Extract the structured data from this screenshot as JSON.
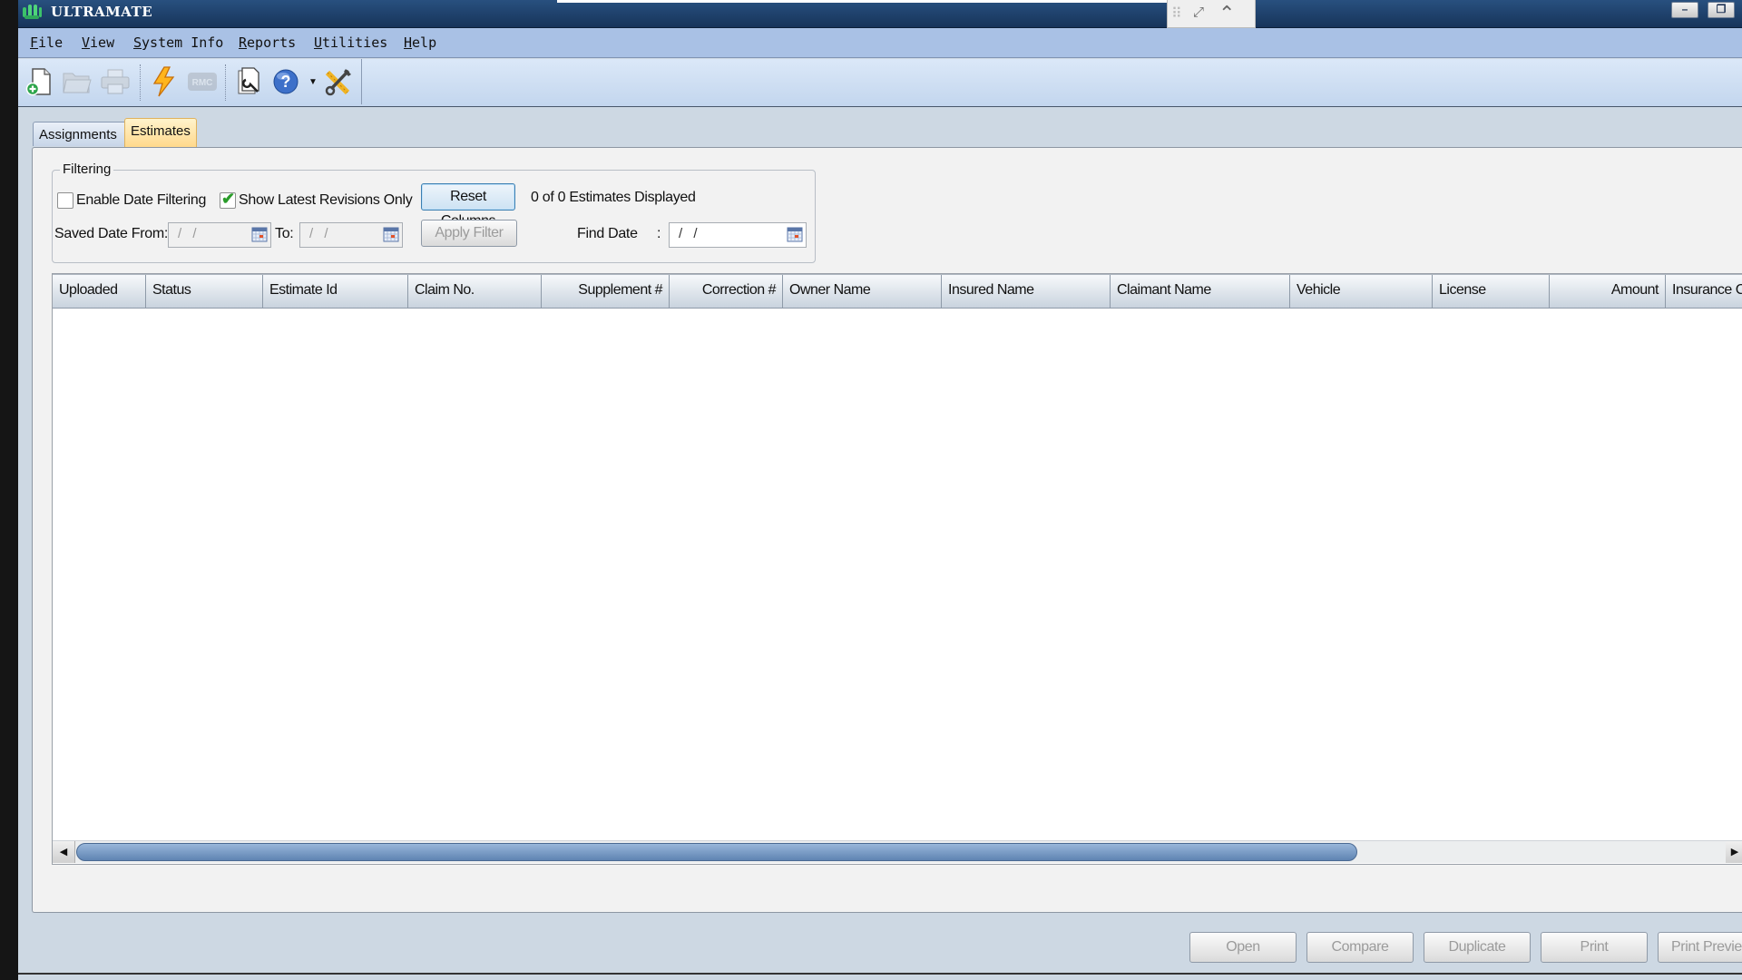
{
  "window": {
    "title": "ULTRAMATE",
    "controls": {
      "minimize": "–",
      "restore": "❐"
    }
  },
  "remote_toolbar": {
    "icons": [
      "pin-grid-icon",
      "fullscreen-icon",
      "collapse-icon"
    ]
  },
  "menu": {
    "items": [
      {
        "label": "File",
        "accel": "F"
      },
      {
        "label": "View",
        "accel": "V"
      },
      {
        "label": "System Info",
        "accel": "S"
      },
      {
        "label": "Reports",
        "accel": "R"
      },
      {
        "label": "Utilities",
        "accel": "U"
      },
      {
        "label": "Help",
        "accel": "H"
      }
    ]
  },
  "toolbar": {
    "buttons": [
      {
        "name": "new",
        "icon": "new-document-icon",
        "enabled": true
      },
      {
        "name": "open",
        "icon": "open-folder-icon",
        "enabled": false
      },
      {
        "name": "print",
        "icon": "printer-icon",
        "enabled": false
      },
      {
        "name": "quick",
        "icon": "lightning-icon",
        "enabled": true
      },
      {
        "name": "rmc",
        "icon": "rmc-icon",
        "label": "RMC",
        "enabled": false
      },
      {
        "name": "edit",
        "icon": "document-wrench-icon",
        "enabled": true
      },
      {
        "name": "help",
        "icon": "help-icon",
        "enabled": true
      },
      {
        "name": "tools",
        "icon": "tools-icon",
        "enabled": true
      }
    ]
  },
  "tabs": [
    {
      "label": "Assignments",
      "active": false
    },
    {
      "label": "Estimates",
      "active": true
    }
  ],
  "filtering": {
    "legend": "Filtering",
    "enable_date_filtering": {
      "label": "Enable Date Filtering",
      "checked": false
    },
    "show_latest_revisions": {
      "label": "Show Latest Revisions Only",
      "checked": true
    },
    "reset_columns_label": "Reset Columns",
    "status_text": "0 of 0 Estimates Displayed",
    "saved_date_from_label": "Saved Date From:",
    "saved_date_from_value": "/ /",
    "to_label": "To:",
    "to_value": "/ /",
    "apply_filter_label": "Apply Filter",
    "find_date_label": "Find Date",
    "find_date_colon": ":",
    "find_date_value": "/ /"
  },
  "grid": {
    "columns": [
      {
        "label": "Uploaded",
        "align": "left"
      },
      {
        "label": "Status",
        "align": "left"
      },
      {
        "label": "Estimate Id",
        "align": "left"
      },
      {
        "label": "Claim No.",
        "align": "left"
      },
      {
        "label": "Supplement #",
        "align": "right"
      },
      {
        "label": "Correction #",
        "align": "right"
      },
      {
        "label": "Owner Name",
        "align": "left"
      },
      {
        "label": "Insured Name",
        "align": "left"
      },
      {
        "label": "Claimant Name",
        "align": "left"
      },
      {
        "label": "Vehicle",
        "align": "left"
      },
      {
        "label": "License",
        "align": "left"
      },
      {
        "label": "Amount",
        "align": "right"
      },
      {
        "label": "Insurance C",
        "align": "left"
      }
    ],
    "rows": [],
    "scroll": {
      "left_arrow": "◀",
      "right_arrow": "▶"
    }
  },
  "actions": [
    {
      "label": "Open",
      "enabled": false
    },
    {
      "label": "Compare",
      "enabled": false
    },
    {
      "label": "Duplicate",
      "enabled": false
    },
    {
      "label": "Print",
      "enabled": false
    },
    {
      "label": "Print Previe",
      "enabled": false
    }
  ]
}
